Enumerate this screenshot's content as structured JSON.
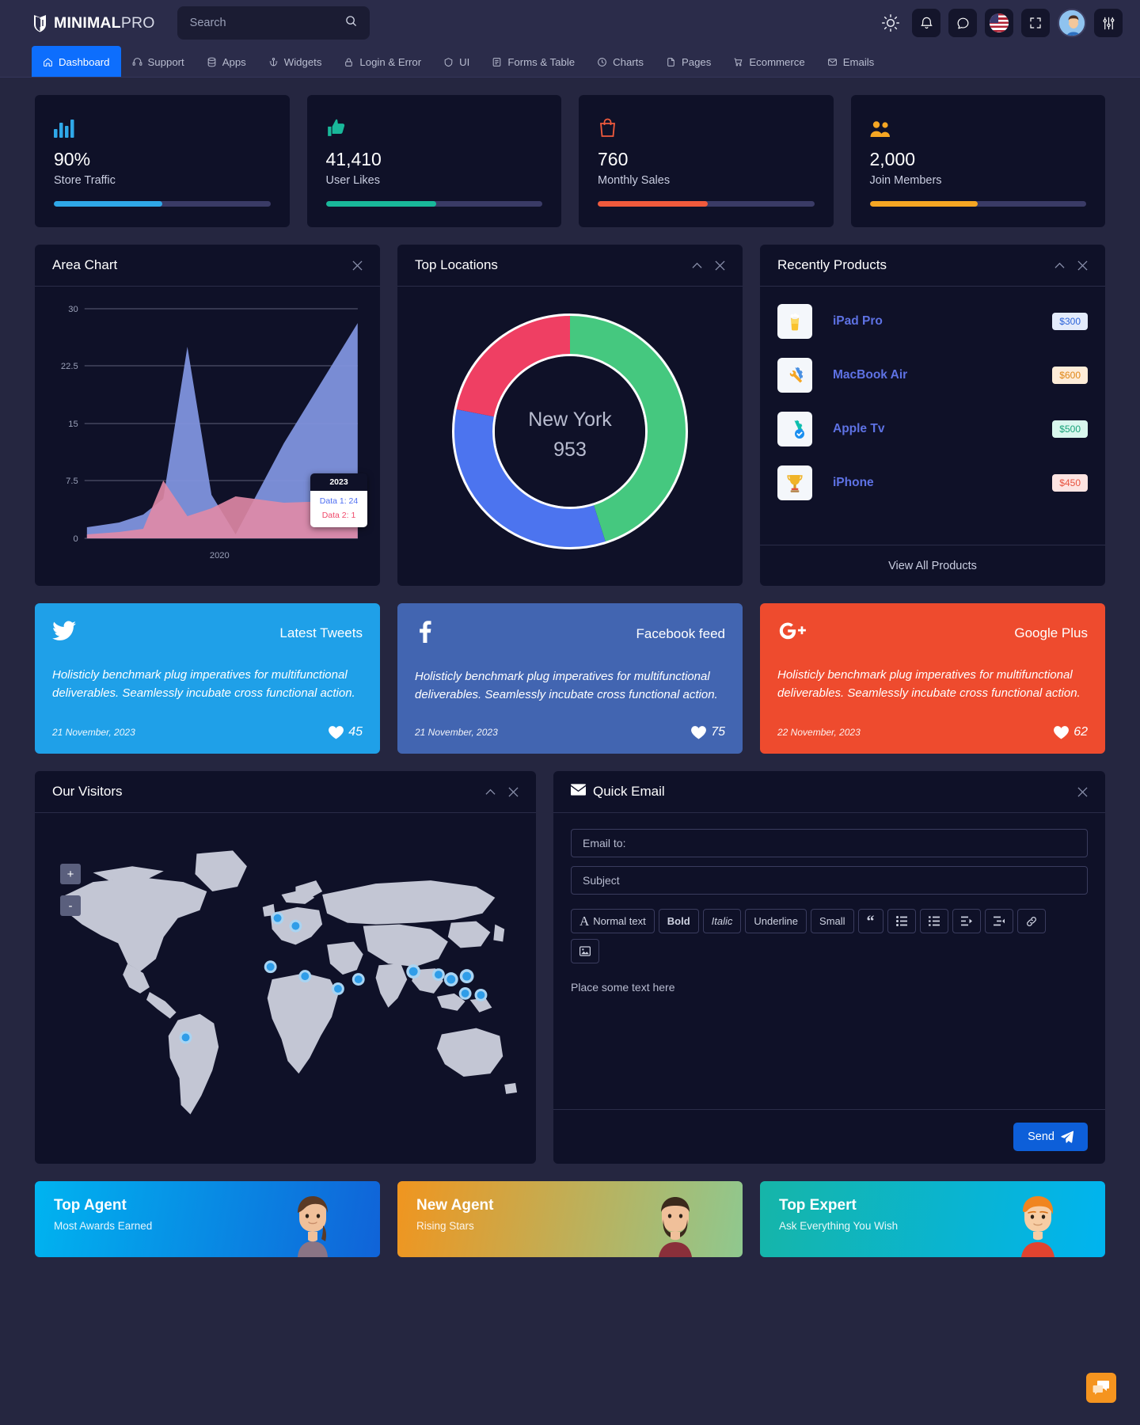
{
  "brand": {
    "strong": "MINIMAL",
    "light": "PRO"
  },
  "search": {
    "placeholder": "Search",
    "value": ""
  },
  "header_icons": [
    {
      "name": "sun-icon",
      "label": "theme-toggle"
    },
    {
      "name": "bell-icon",
      "label": "notifications"
    },
    {
      "name": "chat-icon",
      "label": "messages"
    },
    {
      "name": "flag-us-icon",
      "label": "language"
    },
    {
      "name": "fullscreen-icon",
      "label": "fullscreen"
    },
    {
      "name": "avatar",
      "label": "profile"
    },
    {
      "name": "sliders-icon",
      "label": "settings"
    }
  ],
  "nav": [
    {
      "label": "Dashboard",
      "icon": "home-icon",
      "active": true
    },
    {
      "label": "Support",
      "icon": "headset-icon",
      "active": false
    },
    {
      "label": "Apps",
      "icon": "database-icon",
      "active": false
    },
    {
      "label": "Widgets",
      "icon": "anchor-icon",
      "active": false
    },
    {
      "label": "Login & Error",
      "icon": "lock-icon",
      "active": false
    },
    {
      "label": "UI",
      "icon": "box-icon",
      "active": false
    },
    {
      "label": "Forms & Table",
      "icon": "form-icon",
      "active": false
    },
    {
      "label": "Charts",
      "icon": "clock-icon",
      "active": false
    },
    {
      "label": "Pages",
      "icon": "page-icon",
      "active": false
    },
    {
      "label": "Ecommerce",
      "icon": "cart-icon",
      "active": false
    },
    {
      "label": "Emails",
      "icon": "envelope-icon",
      "active": false
    }
  ],
  "stats": [
    {
      "icon": "bar-chart-icon",
      "value": "90%",
      "label": "Store Traffic",
      "percent": 50,
      "color": "#2fa8e8",
      "track": "#3a3b66"
    },
    {
      "icon": "thumbs-up-icon",
      "value": "41,410",
      "label": "User Likes",
      "percent": 51,
      "color": "#19b89a",
      "track": "#3a3b66"
    },
    {
      "icon": "shopping-bag-icon",
      "value": "760",
      "label": "Monthly Sales",
      "percent": 51,
      "color": "#f05a3c",
      "track": "#3a3b66"
    },
    {
      "icon": "users-icon",
      "value": "2,000",
      "label": "Join Members",
      "percent": 50,
      "color": "#f5a623",
      "track": "#3a3b66"
    }
  ],
  "area_panel": {
    "title": "Area Chart",
    "close": "×"
  },
  "locations_panel": {
    "title": "Top Locations",
    "collapse": "^",
    "close": "×"
  },
  "products_panel": {
    "title": "Recently Products",
    "collapse": "^",
    "close": "×",
    "view_all": "View All Products",
    "items": [
      {
        "icon": "beer-icon",
        "glyph": "🍺",
        "name": "iPad Pro",
        "price": "$300",
        "badge_bg": "#e3ebfb",
        "badge_fg": "#2b63d9"
      },
      {
        "icon": "gear-wrench-icon",
        "glyph": "🛠️",
        "name": "MacBook Air",
        "price": "$600",
        "badge_bg": "#fdecd8",
        "badge_fg": "#e08717"
      },
      {
        "icon": "gear-check-icon",
        "glyph": "⚙️",
        "name": "Apple Tv",
        "price": "$500",
        "badge_bg": "#d9f7ee",
        "badge_fg": "#1aa37a"
      },
      {
        "icon": "trophy-icon",
        "glyph": "🏆",
        "name": "iPhone",
        "price": "$450",
        "badge_bg": "#fde4e2",
        "badge_fg": "#e8533f"
      }
    ]
  },
  "social": [
    {
      "network": "twitter",
      "icon": "twitter-icon",
      "title": "Latest Tweets",
      "text": "Holisticly benchmark plug imperatives for multifunctional deliverables. Seamlessly incubate cross functional action.",
      "date": "21 November, 2023",
      "likes": "45",
      "bg": "#1fa0e8"
    },
    {
      "network": "facebook",
      "icon": "facebook-icon",
      "title": "Facebook feed",
      "text": "Holisticly benchmark plug imperatives for multifunctional deliverables. Seamlessly incubate cross functional action.",
      "date": "21 November, 2023",
      "likes": "75",
      "bg": "#4265b1"
    },
    {
      "network": "googleplus",
      "icon": "googleplus-icon",
      "title": "Google Plus",
      "text": "Holisticly benchmark plug imperatives for multifunctional deliverables. Seamlessly incubate cross functional action.",
      "date": "22 November, 2023",
      "likes": "62",
      "bg": "#ee4b2e"
    }
  ],
  "visitors_panel": {
    "title": "Our Visitors",
    "collapse": "^",
    "close": "×",
    "zoom_in": "+",
    "zoom_out": "-"
  },
  "email_panel": {
    "title": "Quick Email",
    "close": "×",
    "to_placeholder": "Email to:",
    "to_value": "",
    "subject_placeholder": "Subject",
    "subject_value": "",
    "body_placeholder": "Place some text here",
    "body_value": "",
    "send_label": "Send",
    "toolbar": [
      {
        "name": "normal-text-button",
        "label": "Normal text",
        "style": "normal",
        "icon": "A"
      },
      {
        "name": "bold-button",
        "label": "Bold",
        "style": "bold"
      },
      {
        "name": "italic-button",
        "label": "Italic",
        "style": "italic"
      },
      {
        "name": "underline-button",
        "label": "Underline",
        "style": "normal"
      },
      {
        "name": "small-button",
        "label": "Small",
        "style": "normal"
      },
      {
        "name": "blockquote-button",
        "label": "“",
        "style": "quote"
      },
      {
        "name": "unordered-list-button",
        "label": "",
        "style": "icon-ul"
      },
      {
        "name": "ordered-list-button",
        "label": "",
        "style": "icon-ol"
      },
      {
        "name": "indent-button",
        "label": "",
        "style": "icon-indent"
      },
      {
        "name": "outdent-button",
        "label": "",
        "style": "icon-outdent"
      },
      {
        "name": "link-button",
        "label": "",
        "style": "icon-link"
      },
      {
        "name": "image-button",
        "label": "",
        "style": "icon-image"
      }
    ]
  },
  "agents": [
    {
      "title": "Top Agent",
      "subtitle": "Most Awards Earned",
      "grad_from": "#00b4f0",
      "grad_to": "#1063d8",
      "avatar": "woman"
    },
    {
      "title": "New Agent",
      "subtitle": "Rising Stars",
      "grad_from": "#f0951f",
      "grad_to": "#8fc88f",
      "avatar": "man-beard"
    },
    {
      "title": "Top Expert",
      "subtitle": "Ask Everything You Wish",
      "grad_from": "#16b5a8",
      "grad_to": "#00b4f0",
      "avatar": "man-red"
    }
  ],
  "fab": {
    "name": "chat-fab",
    "color": "#f5941f"
  },
  "chart_data": [
    {
      "type": "area",
      "title": "Area Chart",
      "xlabel": "",
      "ylabel": "",
      "ylim": [
        0,
        30
      ],
      "yticks": [
        0,
        7.5,
        15,
        22.5,
        30
      ],
      "ytick_labels": [
        "0",
        "7.5",
        "15",
        "22.5",
        "30"
      ],
      "xtick_labels": [
        "2020"
      ],
      "grid": true,
      "legend": "none",
      "tooltip": {
        "x": "2023",
        "entries": [
          {
            "label": "Data 1: 24",
            "color": "#4e6ef2"
          },
          {
            "label": "Data 2: 1",
            "color": "#ef4a6b"
          }
        ]
      },
      "series": [
        {
          "name": "Data 1",
          "color": "#8093dd",
          "values": [
            1.5,
            2,
            3,
            5,
            25,
            3,
            1,
            12,
            24
          ]
        },
        {
          "name": "Data 2",
          "color": "#e18aa6",
          "values": [
            0.5,
            1,
            1.5,
            7.5,
            3,
            4,
            5.5,
            4.5,
            5
          ]
        }
      ]
    },
    {
      "type": "pie",
      "title": "Top Locations",
      "center_label": "New York",
      "center_value": "953",
      "labels": [
        "Green",
        "Blue",
        "Pink"
      ],
      "values": [
        45,
        33,
        22
      ],
      "colors": [
        "#45c87f",
        "#4c74ef",
        "#ef3f63"
      ],
      "legend": "none"
    }
  ]
}
